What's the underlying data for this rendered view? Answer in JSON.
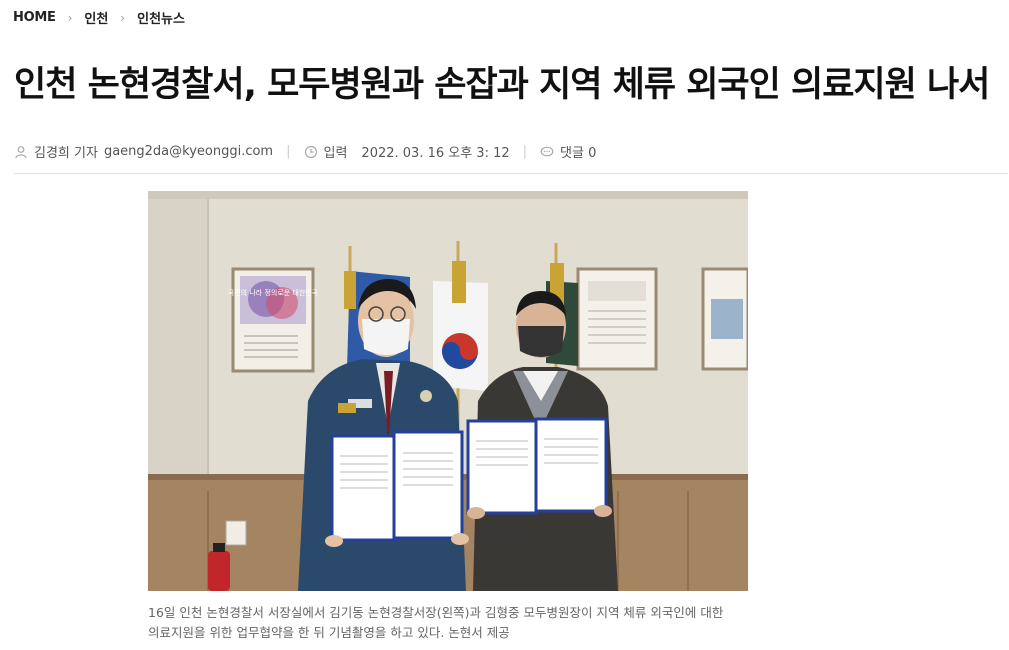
{
  "breadcrumb": {
    "home": "HOME",
    "items": [
      "인천",
      "인천뉴스"
    ]
  },
  "article": {
    "title": "인천 논현경찰서, 모두병원과 손잡과 지역 체류 외국인 의료지원 나서",
    "author": "김경희 기자",
    "email": "gaeng2da@kyeonggi.com",
    "published_label": "입력",
    "published_date": "2022. 03. 16 오후 3: 12",
    "comments_label": "댓글",
    "comments_count": "0",
    "caption_line1": "16일 인천 논현경찰서 서장실에서 김기동 논현경찰서장(왼쪽)과 김형중 모두병원장이 지역 체류 외국인에 대한",
    "caption_line2": "의료지원을 위한 업무협약을 한 뒤 기념촬영을 하고 있다. 논현서 제공"
  },
  "photo": {
    "poster_text": "국민의 나라 정의로운 대한민국"
  },
  "icons": {
    "author": "user-icon",
    "time": "clock-icon",
    "comments": "comment-icon"
  },
  "colors": {
    "title": "#111111",
    "meta": "#555555",
    "caption": "#666666"
  }
}
